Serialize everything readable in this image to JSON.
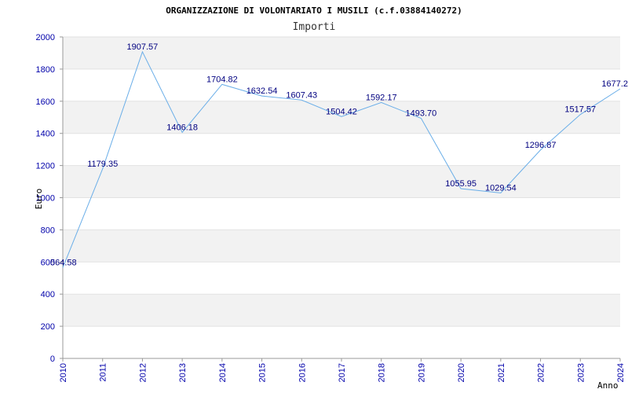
{
  "chart_data": {
    "type": "line",
    "title": "ORGANIZZAZIONE DI VOLONTARIATO I MUSILI (c.f.03884140272)",
    "subtitle": "Importi",
    "xlabel": "Anno",
    "ylabel": "Euro",
    "ylim": [
      0,
      2000
    ],
    "yticks": [
      "0",
      "200",
      "400",
      "600",
      "800",
      "1000",
      "1200",
      "1400",
      "1600",
      "1800",
      "2000"
    ],
    "grid": "horizontal bands",
    "categories": [
      "2010",
      "2011",
      "2012",
      "2013",
      "2014",
      "2015",
      "2016",
      "2017",
      "2018",
      "2019",
      "2020",
      "2021",
      "2022",
      "2023",
      "2024"
    ],
    "values": [
      564.58,
      1179.35,
      1907.57,
      1406.18,
      1704.82,
      1632.54,
      1607.43,
      1504.42,
      1592.17,
      1493.7,
      1055.95,
      1029.54,
      1296.87,
      1517.57,
      1677.2
    ],
    "data_labels": [
      "564.58",
      "1179.35",
      "1907.57",
      "1406.18",
      "1704.82",
      "1632.54",
      "1607.43",
      "1504.42",
      "1592.17",
      "1493.70",
      "1055.95",
      "1029.54",
      "1296.87",
      "1517.57",
      "1677.2"
    ],
    "colors": {
      "line": "#6aaee8",
      "band": "#f2f2f2",
      "tick": "#0000aa",
      "label": "#000080"
    }
  }
}
